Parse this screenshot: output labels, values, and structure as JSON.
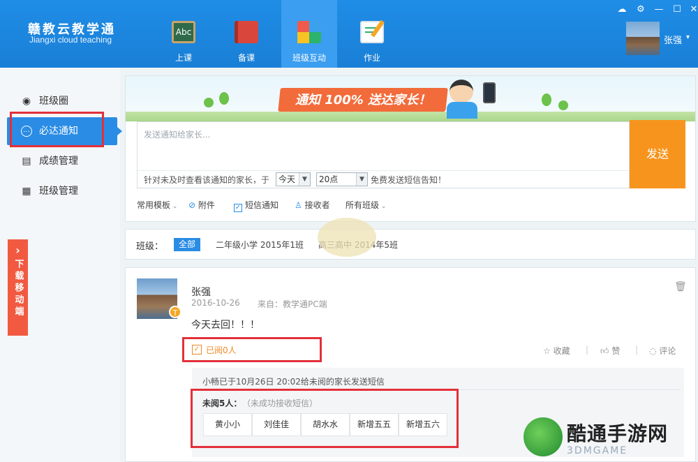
{
  "app": {
    "brand_cn": "赣教云教学通",
    "brand_en": "Jiangxi cloud teaching"
  },
  "nav": {
    "tabs": [
      {
        "label": "上课",
        "icon": "abc-board-icon"
      },
      {
        "label": "备课",
        "icon": "book-icon"
      },
      {
        "label": "班级互动",
        "icon": "blocks-icon",
        "active": true
      },
      {
        "label": "作业",
        "icon": "edit-doc-icon"
      }
    ]
  },
  "window": {
    "cloud": "☁",
    "settings": "⚙",
    "minimize": "—",
    "maximize": "☐",
    "close": "✕"
  },
  "user": {
    "name": "张强",
    "caret": "▾"
  },
  "sidebar": {
    "items": [
      {
        "label": "班级圈",
        "icon": "user-circle-icon",
        "glyph": "◉"
      },
      {
        "label": "必达通知",
        "icon": "chat-dots-icon",
        "glyph": "…",
        "active": true
      },
      {
        "label": "成绩管理",
        "icon": "clipboard-icon",
        "glyph": "▤"
      },
      {
        "label": "班级管理",
        "icon": "grid-icon",
        "glyph": "▦"
      }
    ],
    "download_arrow": "›",
    "download_tab": "下载移动端"
  },
  "compose": {
    "banner_text": "通知 100% 送达家长！",
    "placeholder": "发送通知给家长...",
    "sms_hint": "针对未及时查看该通知的家长，于",
    "day_select": "今天",
    "hour_select": "20点",
    "sms_tail": "免费发送短信告知！",
    "send_label": "发送",
    "tools": {
      "template": "常用模板",
      "attachment": "附件",
      "sms": "短信通知",
      "recipients": "接收者",
      "all_classes": "所有班级"
    }
  },
  "filter": {
    "label": "班级：",
    "all": "全部",
    "options": [
      "二年级小学 2015年1班",
      "高三高中 2014年5班"
    ]
  },
  "post": {
    "author": "张强",
    "teacher_badge": "T",
    "date": "2016-10-26",
    "source": "来自：教学通PC端",
    "body": "今天去回！！！",
    "read_count": "已阅0人",
    "actions": {
      "favorite": "收藏",
      "like": "赞",
      "comment": "评论"
    },
    "sms_notice": "小畅已于10月26日 20:02给未阅的家长发送短信",
    "unread_title": "未阅5人：",
    "unread_sub": "（未成功接收短信）",
    "unread_names": [
      "黄小小",
      "刘佳佳",
      "胡水水",
      "新增五五",
      "新增五六"
    ]
  },
  "watermark": {
    "text": "酷通手游网",
    "sub": "3DMGAME"
  },
  "colors": {
    "header": "#1f8de6",
    "accent": "#2a8ce4",
    "send": "#f7941d",
    "highlight": "#e3303a",
    "download_tab": "#f15a40"
  }
}
